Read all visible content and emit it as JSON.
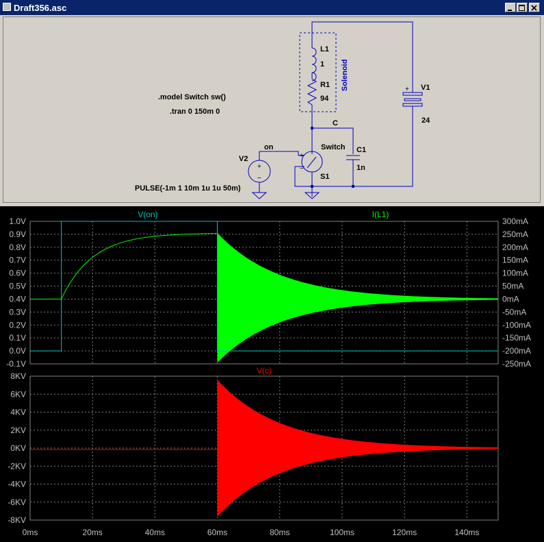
{
  "window": {
    "title": "Draft356.asc"
  },
  "schematic": {
    "directives": {
      "model": ".model Switch sw()",
      "tran": ".tran 0 150m 0"
    },
    "components": {
      "l1": {
        "name": "L1",
        "value": "1"
      },
      "r1": {
        "name": "R1",
        "value": "94"
      },
      "group_label": "Solenoid",
      "v1": {
        "name": "V1",
        "value": "24"
      },
      "c1": {
        "name": "C1",
        "value": "1n"
      },
      "s1": {
        "name": "S1",
        "model": "Switch"
      },
      "v2": {
        "name": "V2",
        "value": "PULSE(-1m 1 10m 1u 1u 50m)"
      }
    },
    "net_labels": {
      "c": "C",
      "on": "on"
    }
  },
  "plot": {
    "x_ticks": [
      "0ms",
      "20ms",
      "40ms",
      "60ms",
      "80ms",
      "100ms",
      "120ms",
      "140ms"
    ],
    "top": {
      "left_trace_label": "V(on)",
      "right_trace_label": "I(L1)",
      "left_ticks": [
        "1.0V",
        "0.9V",
        "0.8V",
        "0.7V",
        "0.6V",
        "0.5V",
        "0.4V",
        "0.3V",
        "0.2V",
        "0.1V",
        "0.0V",
        "-0.1V"
      ],
      "right_ticks": [
        "300mA",
        "250mA",
        "200mA",
        "150mA",
        "100mA",
        "50mA",
        "0mA",
        "-50mA",
        "-100mA",
        "-150mA",
        "-200mA",
        "-250mA"
      ]
    },
    "bottom": {
      "trace_label": "V(c)",
      "left_ticks": [
        "8KV",
        "6KV",
        "4KV",
        "2KV",
        "0KV",
        "-2KV",
        "-4KV",
        "-6KV",
        "-8KV"
      ]
    },
    "colors": {
      "v_on": "#00c0c0",
      "i_l1": "#00ff00",
      "v_c": "#ff0000",
      "grid": "#808080",
      "axis_text": "#c0c0c0"
    }
  }
}
